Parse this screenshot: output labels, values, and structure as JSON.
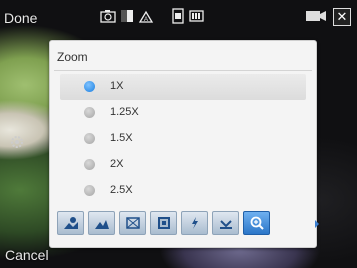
{
  "softkeys": {
    "left": "Done",
    "bottom_left": "Cancel"
  },
  "top_icons": [
    "camera-mode-icon",
    "exposure-icon",
    "white-balance-icon",
    "storage-icon",
    "battery-icon"
  ],
  "zoom_panel": {
    "title": "Zoom",
    "options": [
      {
        "label": "1X",
        "selected": true
      },
      {
        "label": "1.25X",
        "selected": false
      },
      {
        "label": "1.5X",
        "selected": false
      },
      {
        "label": "2X",
        "selected": false
      },
      {
        "label": "2.5X",
        "selected": false
      }
    ]
  },
  "toolbar": {
    "items": [
      "scene-icon",
      "brightness-icon",
      "resolution-icon",
      "quality-icon",
      "flash-icon",
      "effect-icon",
      "zoom-icon"
    ],
    "active": "zoom-icon"
  },
  "colors": {
    "accent": "#1c7fe0",
    "panel_bg": "#f4f4f4"
  }
}
